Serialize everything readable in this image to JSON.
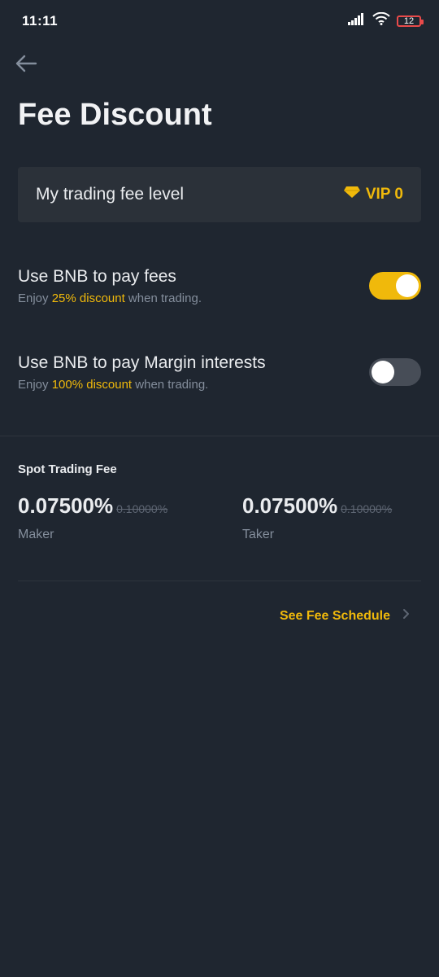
{
  "status_bar": {
    "time": "11:11",
    "battery_level": "12",
    "icons": [
      "signal-icon",
      "wifi-icon",
      "battery-icon"
    ],
    "battery_color": "#e84a4a"
  },
  "header": {
    "back_icon": "arrow-left-icon",
    "title": "Fee Discount"
  },
  "fee_level": {
    "label": "My trading fee level",
    "vip_icon": "diamond-icon",
    "vip_text": "VIP 0"
  },
  "settings": [
    {
      "title": "Use BNB to pay fees",
      "sub_prefix": "Enjoy ",
      "sub_highlight": "25% discount",
      "sub_suffix": " when trading.",
      "enabled": true
    },
    {
      "title": "Use BNB to pay Margin interests",
      "sub_prefix": "Enjoy ",
      "sub_highlight": "100% discount",
      "sub_suffix": " when trading.",
      "enabled": false
    }
  ],
  "spot_fee": {
    "section_title": "Spot Trading Fee",
    "maker": {
      "value": "0.07500%",
      "original": "0.10000%",
      "label": "Maker"
    },
    "taker": {
      "value": "0.07500%",
      "original": "0.10000%",
      "label": "Taker"
    }
  },
  "fee_schedule": {
    "label": "See Fee Schedule",
    "icon": "chevron-right-icon"
  },
  "colors": {
    "background": "#1f2630",
    "card": "#2b3139",
    "accent": "#f0b90b",
    "muted_text": "#848e9c",
    "toggle_off": "#474d57"
  }
}
